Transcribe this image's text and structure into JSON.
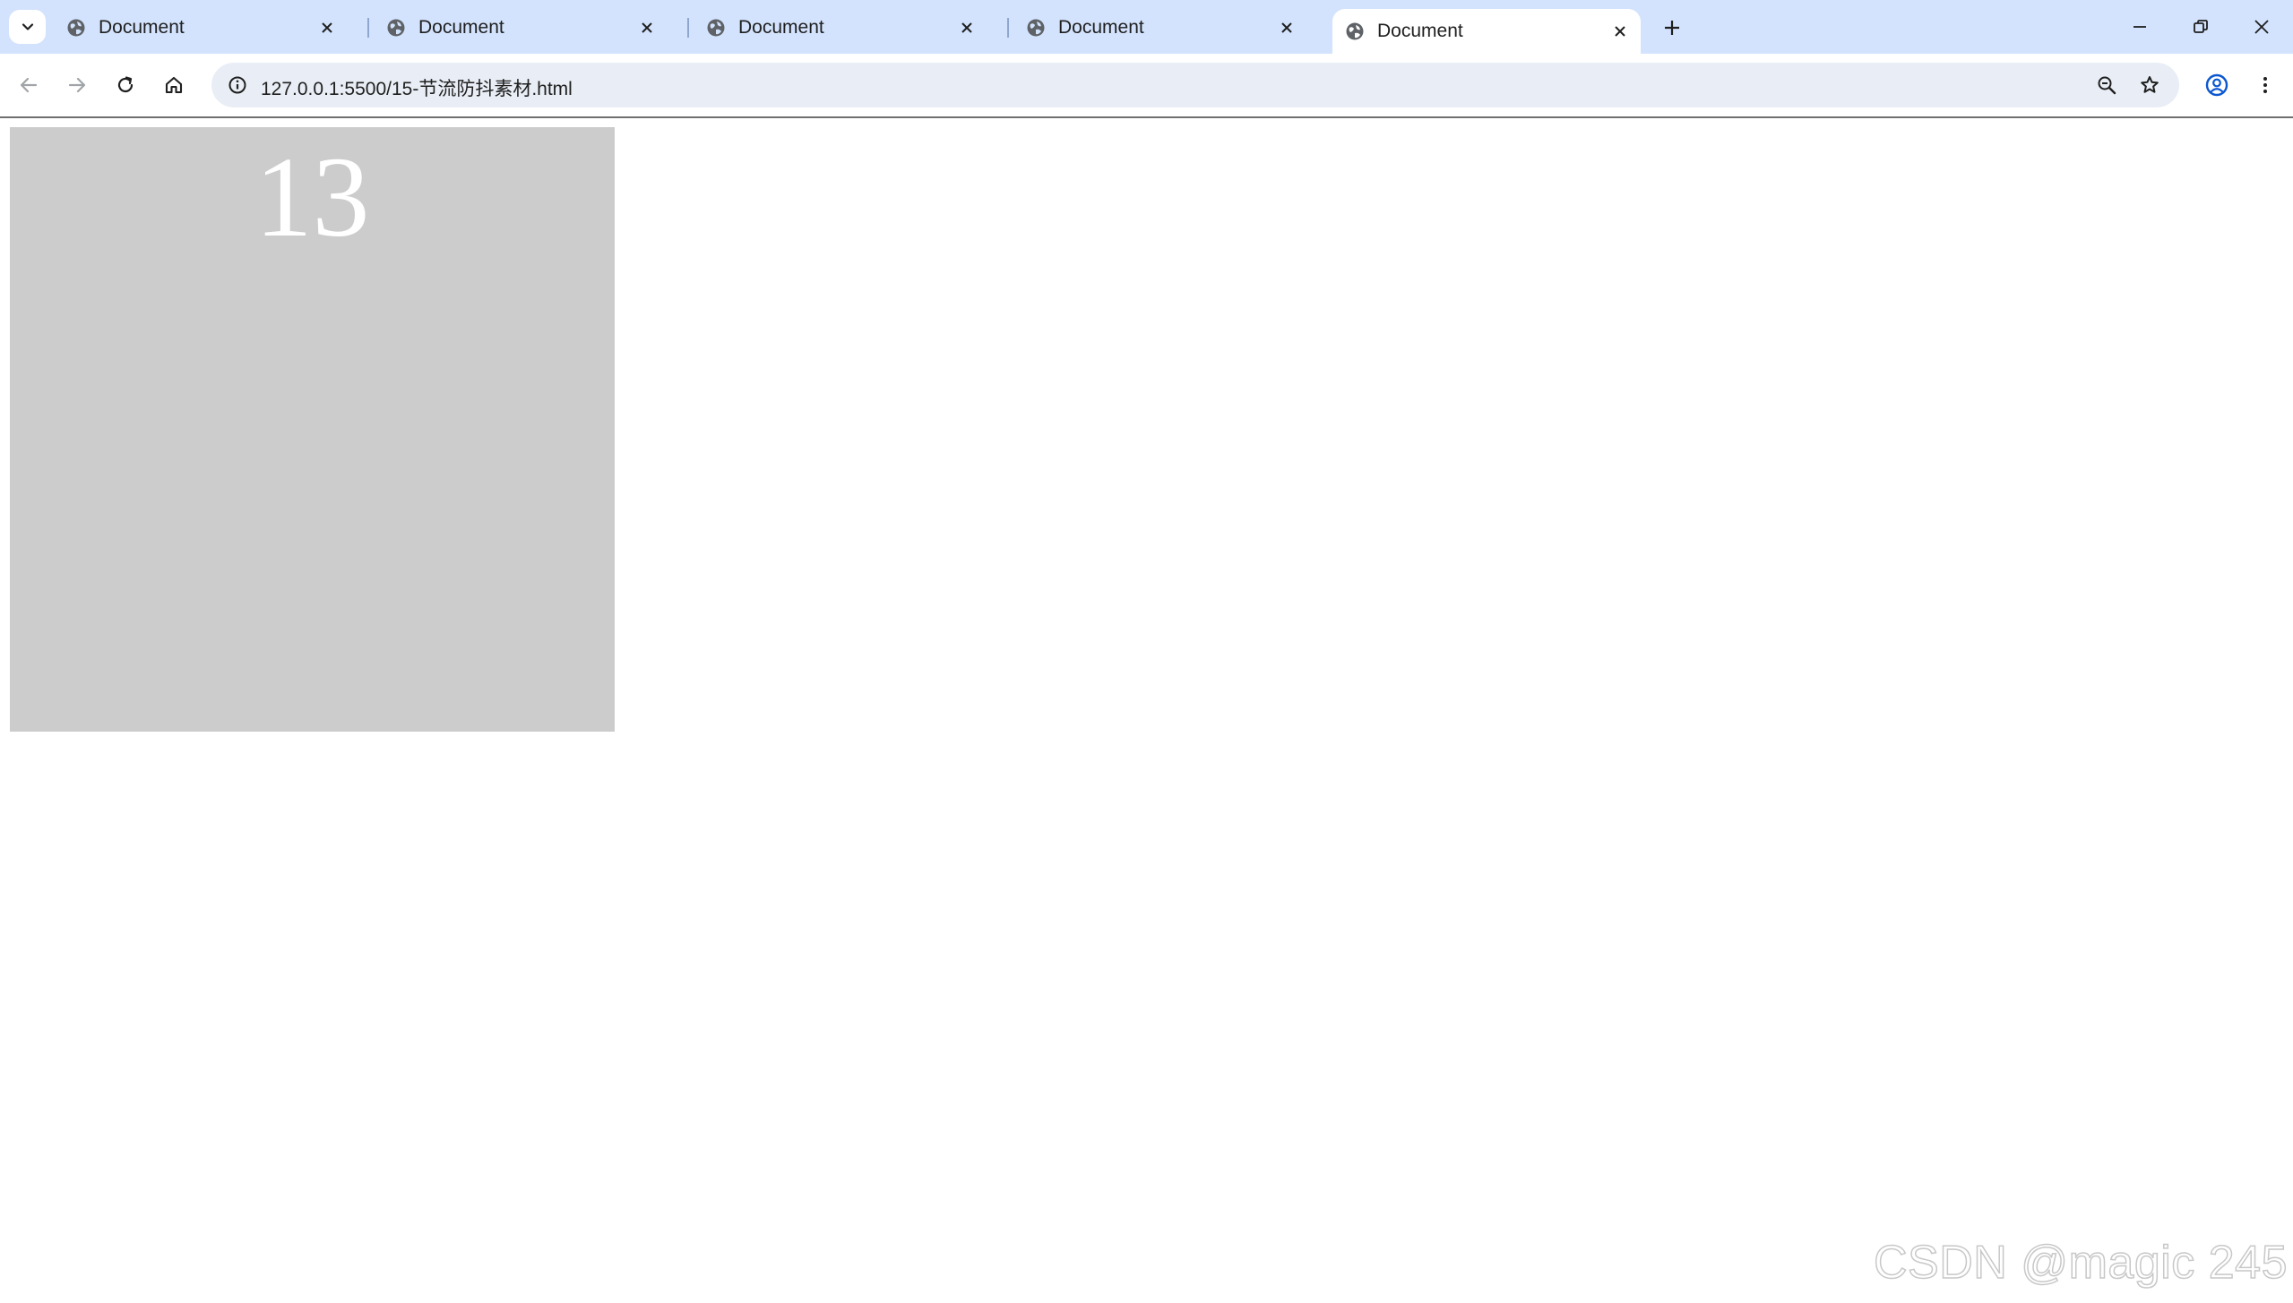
{
  "tabs": [
    {
      "title": "Document",
      "active": false
    },
    {
      "title": "Document",
      "active": false
    },
    {
      "title": "Document",
      "active": false
    },
    {
      "title": "Document",
      "active": false
    },
    {
      "title": "Document",
      "active": true
    }
  ],
  "address_bar": {
    "url": "127.0.0.1:5500/15-节流防抖素材.html"
  },
  "icons": {
    "tab_search": "chevron-down-icon",
    "favicon": "globe-icon",
    "tab_close": "close-icon",
    "new_tab": "plus-icon",
    "minimize": "minimize-icon",
    "restore": "restore-icon",
    "close_window": "close-icon",
    "back": "back-arrow-icon",
    "forward": "forward-arrow-icon",
    "reload": "reload-icon",
    "home": "home-icon",
    "site_info": "info-icon",
    "zoom": "zoom-out-icon",
    "bookmark": "star-icon",
    "profile": "profile-icon",
    "menu": "kebab-menu-icon"
  },
  "page": {
    "counter_value": "13",
    "box_color": "#cccccc"
  },
  "watermark": "CSDN @magic 245",
  "colors": {
    "tabstrip_bg": "#d3e3fd",
    "omnibox_bg": "#e9eef6"
  }
}
